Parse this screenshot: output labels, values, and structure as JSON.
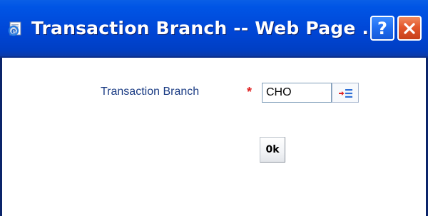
{
  "window": {
    "title": "Transaction Branch -- Web Page ...",
    "help_label": "?"
  },
  "form": {
    "branch_label": "Transaction Branch",
    "required_marker": "*",
    "branch_value": "CHO",
    "lov_icon": "list-of-values-icon",
    "ok_label": "0k"
  },
  "colors": {
    "title_bar": "#0046d6",
    "label_text": "#1b3c84",
    "required_star": "#e02020",
    "close_button": "#e3572c"
  }
}
